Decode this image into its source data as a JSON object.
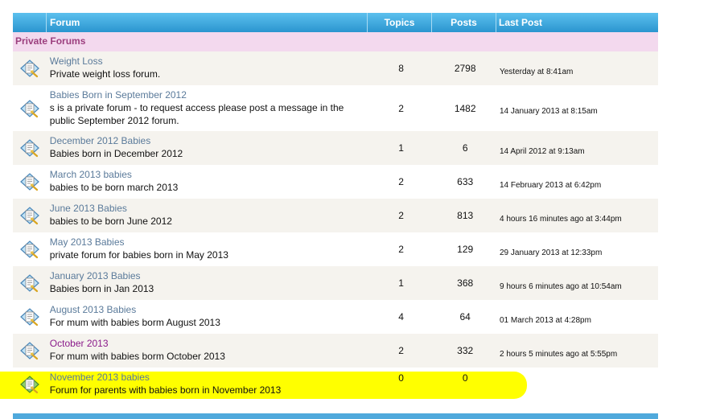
{
  "header": {
    "forum": "Forum",
    "topics": "Topics",
    "posts": "Posts",
    "last_post": "Last Post"
  },
  "category": "Private Forums",
  "rows": [
    {
      "name": "Weight Loss",
      "desc": "Private weight loss forum.",
      "topics": "8",
      "posts": "2798",
      "last": "Yesterday at 8:41am"
    },
    {
      "name": "Babies Born in September 2012",
      "desc": "s is a private forum - to request access please post a message in the public September 2012 forum.",
      "topics": "2",
      "posts": "1482",
      "last": "14 January 2013 at 8:15am"
    },
    {
      "name": "December 2012 Babies",
      "desc": "Babies born in December 2012",
      "topics": "1",
      "posts": "6",
      "last": "14 April 2012 at 9:13am"
    },
    {
      "name": "March 2013 babies",
      "desc": "babies to be born march 2013",
      "topics": "2",
      "posts": "633",
      "last": "14 February 2013 at 6:42pm"
    },
    {
      "name": "June 2013 Babies",
      "desc": "babies to be born June 2012",
      "topics": "2",
      "posts": "813",
      "last": "4 hours 16 minutes ago at 3:44pm"
    },
    {
      "name": "May 2013 Babies",
      "desc": "private forum for babies born in May 2013",
      "topics": "2",
      "posts": "129",
      "last": "29 January 2013 at 12:33pm"
    },
    {
      "name": "January 2013 Babies",
      "desc": "Babies born in Jan 2013",
      "topics": "1",
      "posts": "368",
      "last": "9 hours 6 minutes ago at 10:54am"
    },
    {
      "name": "August 2013 Babies",
      "desc": "For mum with babies borm August 2013",
      "topics": "4",
      "posts": "64",
      "last": "01 March 2013 at 4:28pm"
    },
    {
      "name": "October 2013",
      "desc": "For mum with babies borm October 2013",
      "topics": "2",
      "posts": "332",
      "last": "2 hours 5 minutes ago at 5:55pm"
    },
    {
      "name": "November 2013 babies",
      "desc": "Forum for parents with babies born in November 2013",
      "topics": "0",
      "posts": "0",
      "last": ""
    }
  ],
  "icons": {
    "forum": "forum-document-icon",
    "forum_new": "forum-document-green-icon"
  },
  "colors": {
    "header_bg": "#2f9fd8",
    "category_bg": "#f3d9ee",
    "category_text": "#9c3f7e",
    "link": "#5a7a9a",
    "visited_link": "#8a1a8a",
    "highlight": "#ffff00"
  }
}
